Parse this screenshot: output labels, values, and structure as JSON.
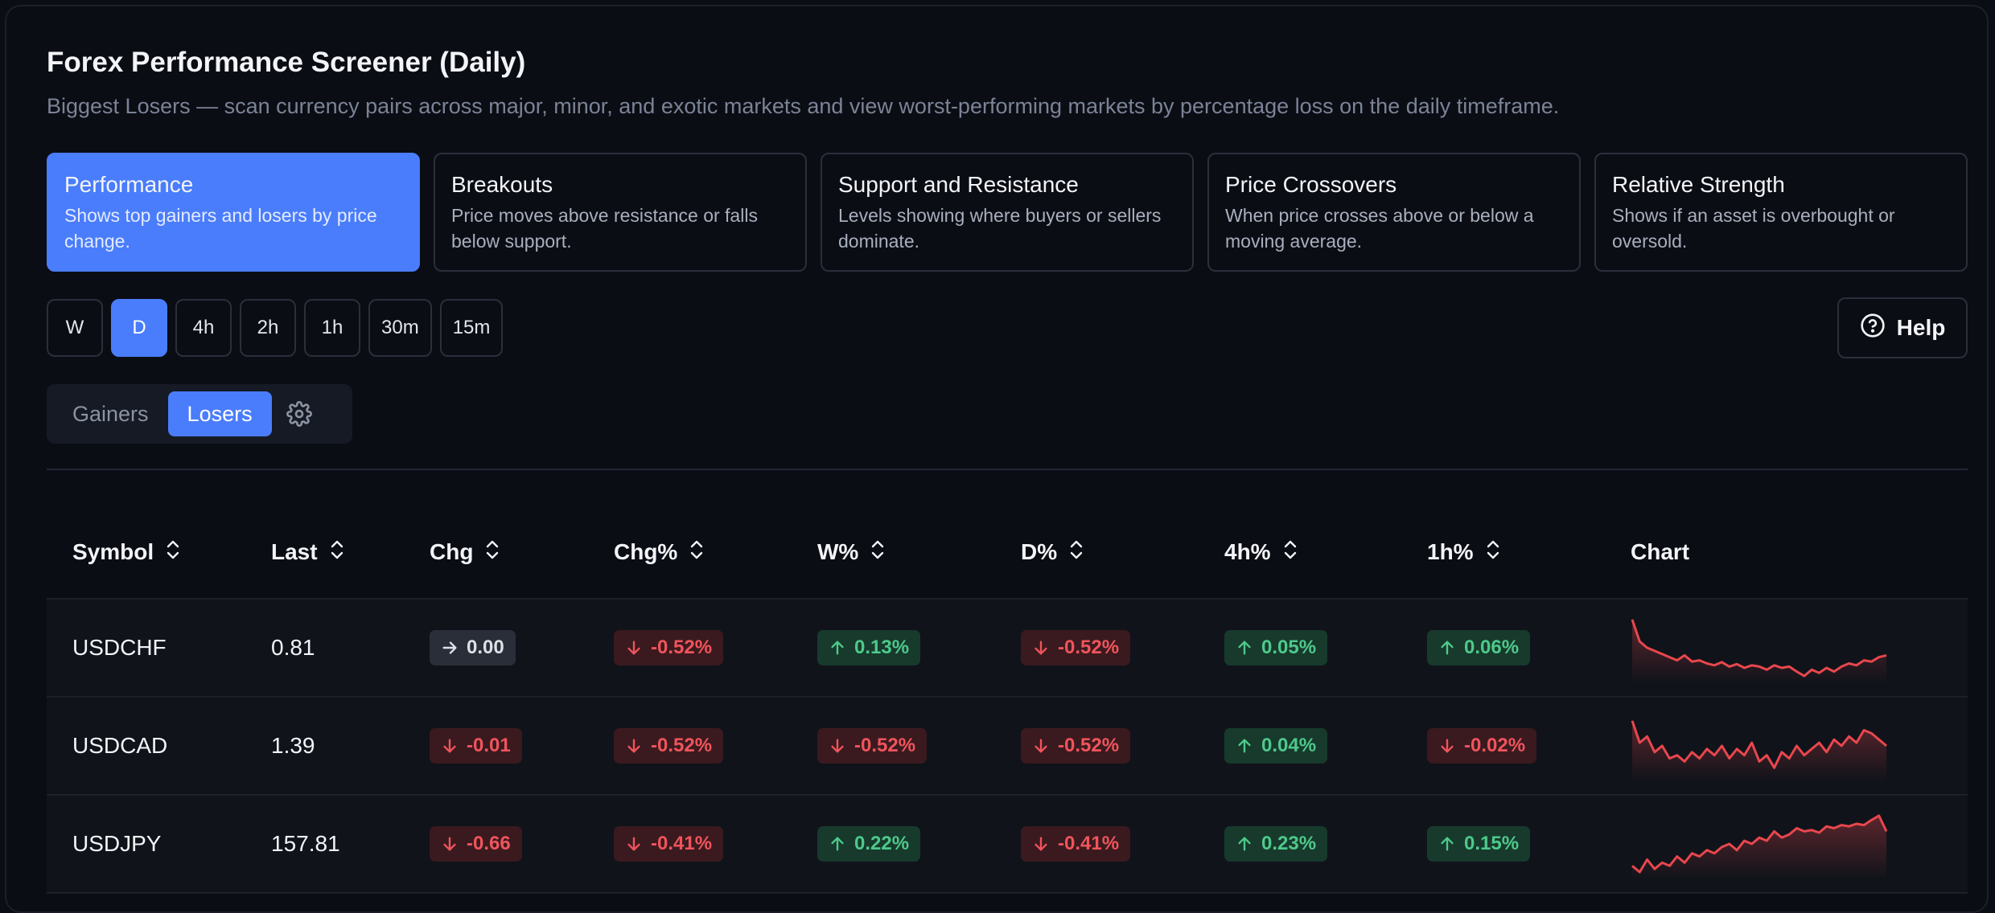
{
  "header": {
    "title": "Forex Performance Screener (Daily)",
    "subtitle": "Biggest Losers — scan currency pairs across major, minor, and exotic markets and view worst-performing markets by percentage loss on the daily timeframe."
  },
  "categories": [
    {
      "title": "Performance",
      "desc": "Shows top gainers and losers by price change."
    },
    {
      "title": "Breakouts",
      "desc": "Price moves above resistance or falls below support."
    },
    {
      "title": "Support and Resistance",
      "desc": "Levels showing where buyers or sellers dominate."
    },
    {
      "title": "Price Crossovers",
      "desc": "When price crosses above or below a moving average."
    },
    {
      "title": "Relative Strength",
      "desc": "Shows if an asset is overbought or oversold."
    }
  ],
  "timeframes": [
    "W",
    "D",
    "4h",
    "2h",
    "1h",
    "30m",
    "15m"
  ],
  "help_label": "Help",
  "toggle": {
    "gainers": "Gainers",
    "losers": "Losers"
  },
  "columns": [
    "Symbol",
    "Last",
    "Chg",
    "Chg%",
    "W%",
    "D%",
    "4h%",
    "1h%",
    "Chart"
  ],
  "rows": [
    {
      "symbol": "USDCHF",
      "last": "0.81",
      "chg": {
        "text": "0.00",
        "dir": "flat"
      },
      "chgp": {
        "text": "-0.52%",
        "dir": "down"
      },
      "w": {
        "text": "0.13%",
        "dir": "up"
      },
      "d": {
        "text": "-0.52%",
        "dir": "down"
      },
      "h4": {
        "text": "0.05%",
        "dir": "up"
      },
      "h1": {
        "text": "0.06%",
        "dir": "up"
      }
    },
    {
      "symbol": "USDCAD",
      "last": "1.39",
      "chg": {
        "text": "-0.01",
        "dir": "down"
      },
      "chgp": {
        "text": "-0.52%",
        "dir": "down"
      },
      "w": {
        "text": "-0.52%",
        "dir": "down"
      },
      "d": {
        "text": "-0.52%",
        "dir": "down"
      },
      "h4": {
        "text": "0.04%",
        "dir": "up"
      },
      "h1": {
        "text": "-0.02%",
        "dir": "down"
      }
    },
    {
      "symbol": "USDJPY",
      "last": "157.81",
      "chg": {
        "text": "-0.66",
        "dir": "down"
      },
      "chgp": {
        "text": "-0.41%",
        "dir": "down"
      },
      "w": {
        "text": "0.22%",
        "dir": "up"
      },
      "d": {
        "text": "-0.41%",
        "dir": "down"
      },
      "h4": {
        "text": "0.23%",
        "dir": "up"
      },
      "h1": {
        "text": "0.15%",
        "dir": "up"
      }
    }
  ],
  "sparklines": [
    [
      0.95,
      0.6,
      0.5,
      0.45,
      0.4,
      0.35,
      0.3,
      0.38,
      0.28,
      0.3,
      0.25,
      0.22,
      0.27,
      0.2,
      0.24,
      0.18,
      0.22,
      0.2,
      0.15,
      0.22,
      0.18,
      0.2,
      0.12,
      0.05,
      0.15,
      0.1,
      0.18,
      0.12,
      0.2,
      0.25,
      0.22,
      0.3,
      0.28,
      0.35,
      0.38
    ],
    [
      0.9,
      0.55,
      0.65,
      0.4,
      0.5,
      0.3,
      0.35,
      0.25,
      0.4,
      0.3,
      0.45,
      0.35,
      0.5,
      0.3,
      0.45,
      0.35,
      0.55,
      0.25,
      0.35,
      0.15,
      0.4,
      0.3,
      0.5,
      0.35,
      0.45,
      0.55,
      0.4,
      0.6,
      0.5,
      0.65,
      0.55,
      0.75,
      0.7,
      0.6,
      0.5
    ],
    [
      0.15,
      0.05,
      0.25,
      0.1,
      0.2,
      0.15,
      0.3,
      0.2,
      0.35,
      0.3,
      0.4,
      0.35,
      0.45,
      0.5,
      0.4,
      0.55,
      0.5,
      0.6,
      0.55,
      0.7,
      0.6,
      0.65,
      0.75,
      0.7,
      0.72,
      0.68,
      0.78,
      0.75,
      0.8,
      0.78,
      0.82,
      0.8,
      0.88,
      0.95,
      0.7
    ]
  ],
  "colors": {
    "accent": "#4a7dfc",
    "up": "#4ec98a",
    "down": "#f0545c",
    "line": "#e8474d"
  }
}
